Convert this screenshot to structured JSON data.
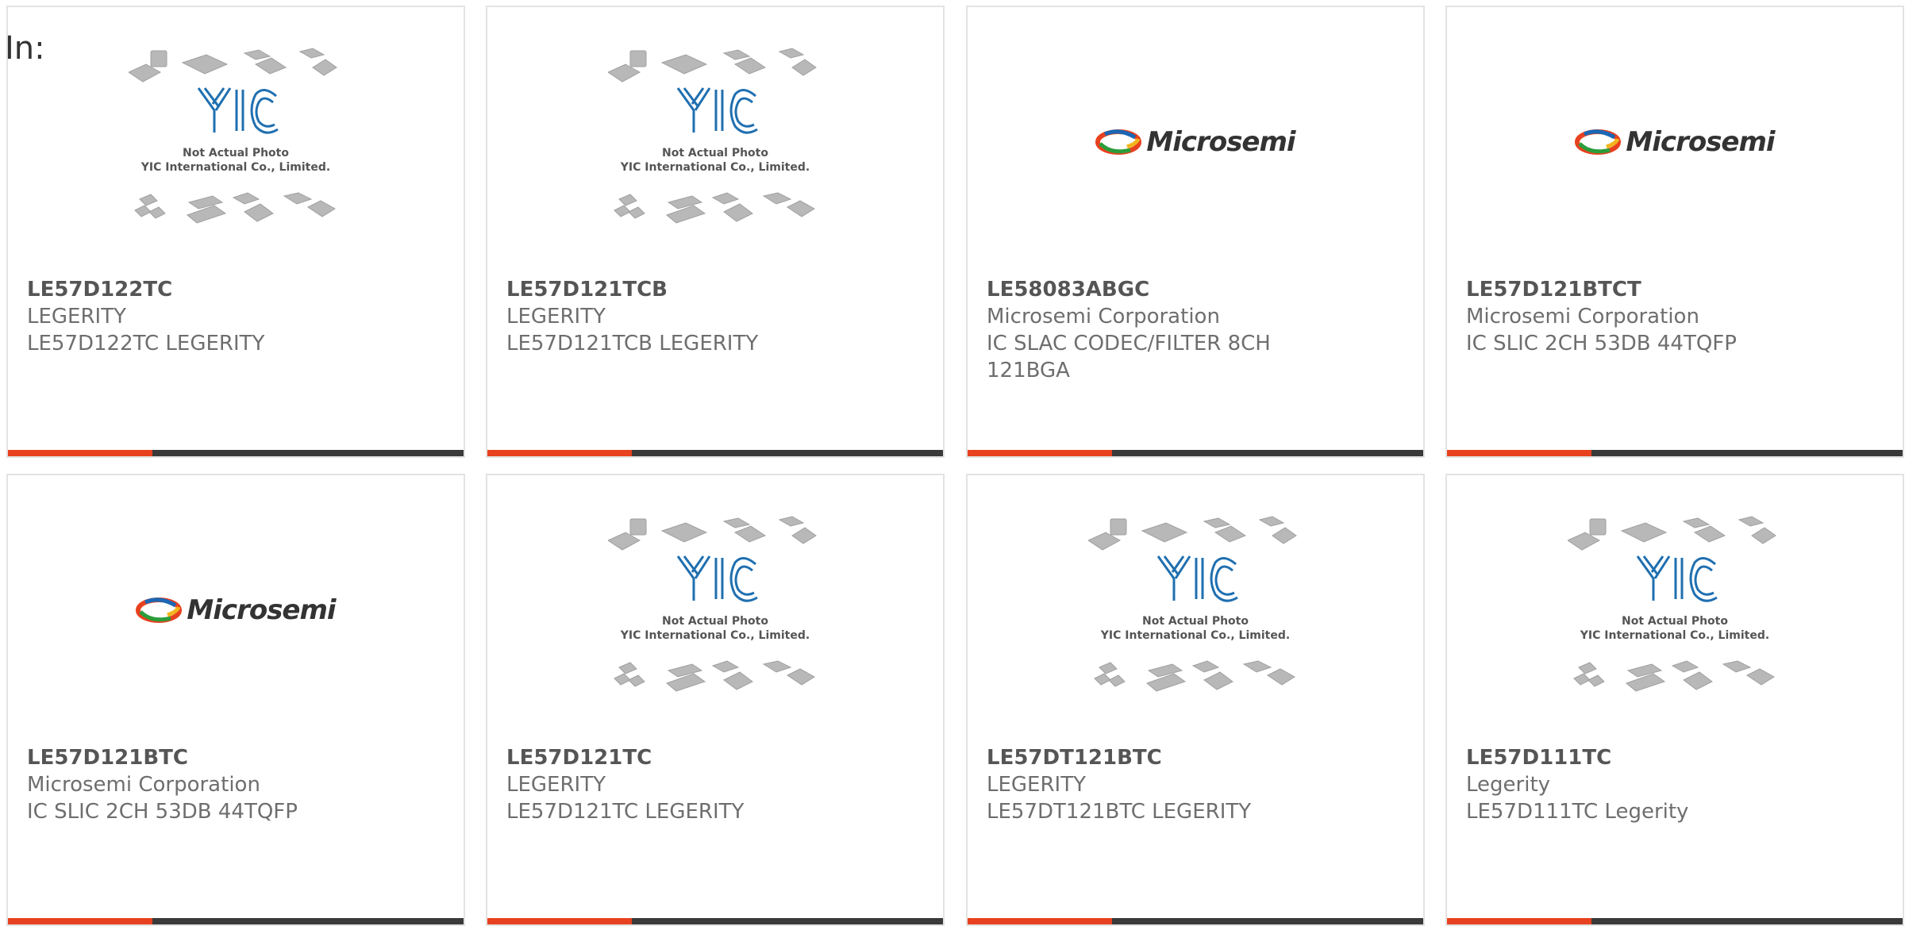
{
  "page": {
    "label": "In:"
  },
  "placeholder": {
    "line1": "Not Actual Photo",
    "line2": "YIC International Co., Limited."
  },
  "brand": {
    "microsemi_word": "Microsemi",
    "accent_color": "#e8411f",
    "bar_color": "#3a3a3a"
  },
  "products": [
    {
      "pn": "LE57D122TC",
      "mfr": "LEGERITY",
      "desc": "LE57D122TC LEGERITY",
      "image": "yic-placeholder"
    },
    {
      "pn": "LE57D121TCB",
      "mfr": "LEGERITY",
      "desc": "LE57D121TCB LEGERITY",
      "image": "yic-placeholder"
    },
    {
      "pn": "LE58083ABGC",
      "mfr": "Microsemi Corporation",
      "desc": "IC SLAC CODEC/FILTER 8CH 121BGA",
      "image": "microsemi-logo"
    },
    {
      "pn": "LE57D121BTCT",
      "mfr": "Microsemi Corporation",
      "desc": "IC SLIC 2CH 53DB 44TQFP",
      "image": "microsemi-logo"
    },
    {
      "pn": "LE57D121BTC",
      "mfr": "Microsemi Corporation",
      "desc": "IC SLIC 2CH 53DB 44TQFP",
      "image": "microsemi-logo"
    },
    {
      "pn": "LE57D121TC",
      "mfr": "LEGERITY",
      "desc": "LE57D121TC LEGERITY",
      "image": "yic-placeholder"
    },
    {
      "pn": "LE57DT121BTC",
      "mfr": "LEGERITY",
      "desc": "LE57DT121BTC LEGERITY",
      "image": "yic-placeholder"
    },
    {
      "pn": "LE57D111TC",
      "mfr": "Legerity",
      "desc": "LE57D111TC Legerity",
      "image": "yic-placeholder"
    }
  ]
}
